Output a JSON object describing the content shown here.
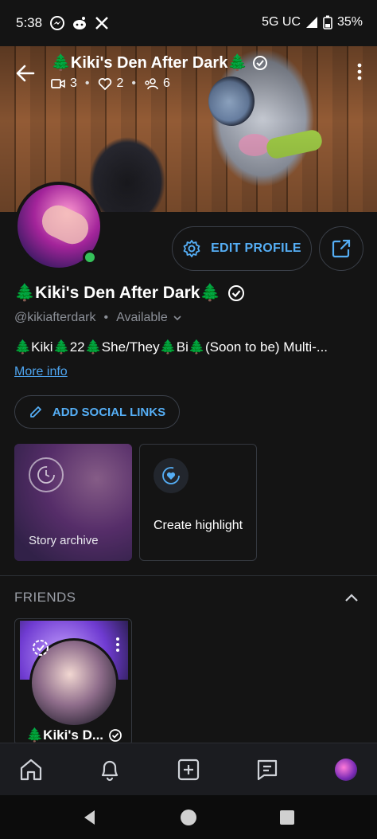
{
  "status_bar": {
    "time": "5:38",
    "network": "5G UC",
    "battery": "35%"
  },
  "cover": {
    "title": "🌲Kiki's Den After Dark🌲",
    "stats": {
      "videos": "3",
      "likes": "2",
      "friends": "6"
    }
  },
  "profile": {
    "name": "🌲Kiki's Den After Dark🌲",
    "handle": "@kikiafterdark",
    "availability": "Available",
    "bio": "🌲Kiki🌲22🌲She/They🌲Bi🌲(Soon to be) Multi-...",
    "more_info": "More info"
  },
  "actions": {
    "edit_profile": "EDIT PROFILE",
    "add_social_links": "ADD SOCIAL LINKS"
  },
  "highlights": [
    {
      "label": "Story archive"
    },
    {
      "label": "Create highlight"
    }
  ],
  "friends": {
    "heading": "FRIENDS",
    "items": [
      {
        "name": "🌲Kiki's D..."
      }
    ]
  },
  "colors": {
    "accent": "#55aef5",
    "background": "#141414",
    "online": "#35c25a"
  },
  "icons": {
    "nav": [
      "home-icon",
      "bell-icon",
      "create-icon",
      "chat-icon",
      "profile-avatar"
    ]
  }
}
